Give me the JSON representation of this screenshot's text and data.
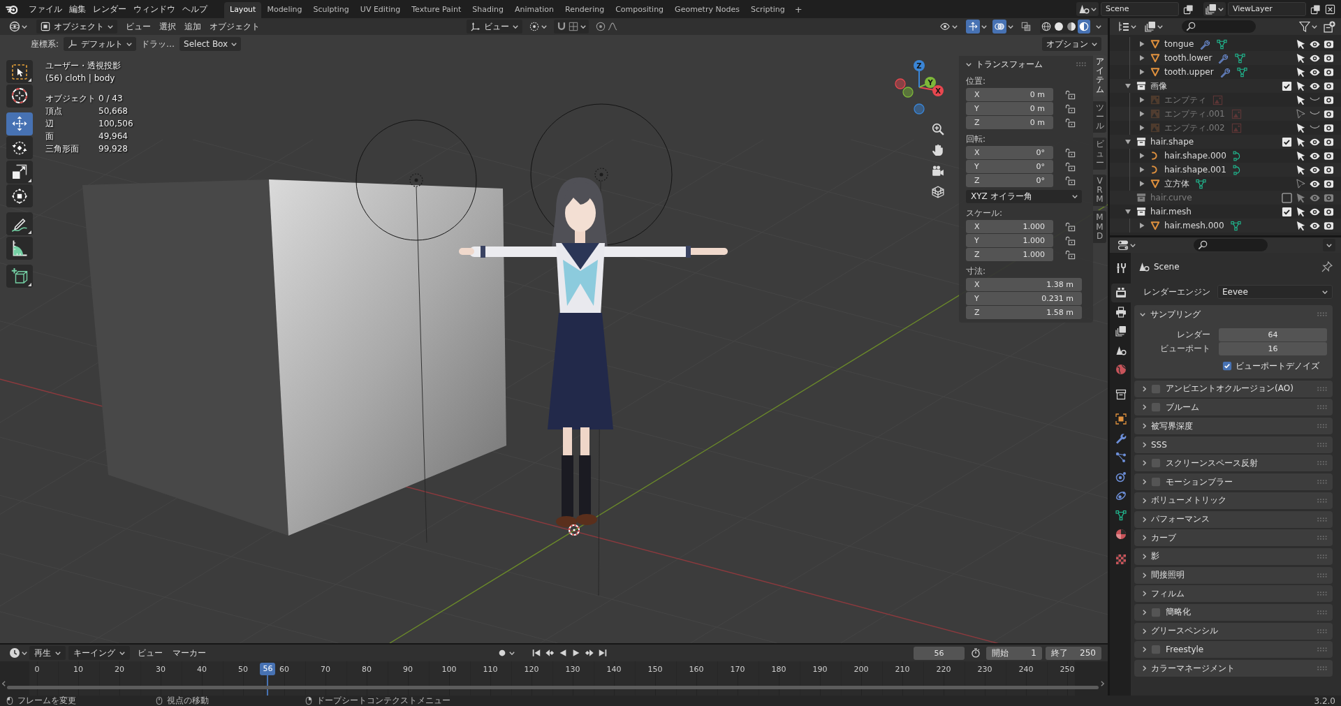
{
  "top_bar": {
    "menus": [
      "ファイル",
      "編集",
      "レンダー",
      "ウィンドウ",
      "ヘルプ"
    ],
    "workspaces": [
      {
        "label": "Layout",
        "selected": true
      },
      {
        "label": "Modeling",
        "selected": false
      },
      {
        "label": "Sculpting",
        "selected": false
      },
      {
        "label": "UV Editing",
        "selected": false
      },
      {
        "label": "Texture Paint",
        "selected": false
      },
      {
        "label": "Shading",
        "selected": false
      },
      {
        "label": "Animation",
        "selected": false
      },
      {
        "label": "Rendering",
        "selected": false
      },
      {
        "label": "Compositing",
        "selected": false
      },
      {
        "label": "Geometry Nodes",
        "selected": false
      },
      {
        "label": "Scripting",
        "selected": false
      }
    ],
    "add_tab": "+",
    "scene": "Scene",
    "view_layer": "ViewLayer"
  },
  "viewport": {
    "header": {
      "mode": "オブジェクト",
      "menus": [
        "ビュー",
        "選択",
        "追加",
        "オブジェクト"
      ],
      "orientation": "ビュー",
      "toggles": [
        {
          "kind": "gizmo",
          "on": true
        },
        {
          "kind": "overlay",
          "on": true
        },
        {
          "kind": "xray",
          "on": false
        }
      ],
      "shading": [
        {
          "kind": "wireframe",
          "selected": false
        },
        {
          "kind": "solid",
          "selected": false
        },
        {
          "kind": "material",
          "selected": false
        },
        {
          "kind": "rendered",
          "selected": true
        }
      ]
    },
    "tool_settings": {
      "orientation_label": "座標系:",
      "orientation": "デフォルト",
      "drag_label": "ドラッ…",
      "drag": "Select Box",
      "options": "オプション"
    },
    "info": {
      "view": "ユーザー・透視投影",
      "context": "(56) cloth | body",
      "stats": [
        {
          "label": "オブジェクト",
          "value": "0 / 43"
        },
        {
          "label": "頂点",
          "value": "50,668"
        },
        {
          "label": "辺",
          "value": "100,506"
        },
        {
          "label": "面",
          "value": "49,964"
        },
        {
          "label": "三角形面",
          "value": "99,928"
        }
      ]
    },
    "tool_groups": [
      {
        "tools": [
          {
            "kind": "select_box",
            "selected": false,
            "variants": true
          },
          {
            "kind": "cursor",
            "selected": false,
            "variants": false
          }
        ]
      },
      {
        "tools": [
          {
            "kind": "move",
            "selected": true,
            "variants": false
          },
          {
            "kind": "rotate",
            "selected": false,
            "variants": false
          },
          {
            "kind": "scale",
            "selected": false,
            "variants": true
          },
          {
            "kind": "transform",
            "selected": false,
            "variants": false
          }
        ]
      },
      {
        "tools": [
          {
            "kind": "annotate",
            "selected": false,
            "variants": true
          },
          {
            "kind": "measure",
            "selected": false,
            "variants": false
          }
        ]
      },
      {
        "tools": [
          {
            "kind": "add_cube",
            "selected": false,
            "variants": true
          }
        ]
      }
    ],
    "gizmo": {
      "axes": [
        {
          "label": "X",
          "color": "#e8474f"
        },
        {
          "label": "Y",
          "color": "#7eb83a"
        },
        {
          "label": "Z",
          "color": "#3a85d6"
        }
      ]
    },
    "sidebar": {
      "title": "トランスフォーム",
      "expanded": true,
      "groups": [
        {
          "label": "位置:",
          "kind": "lockable",
          "fields": [
            {
              "axis": "X",
              "value": "0 m",
              "locked": false
            },
            {
              "axis": "Y",
              "value": "0 m",
              "locked": false
            },
            {
              "axis": "Z",
              "value": "0 m",
              "locked": false
            }
          ]
        },
        {
          "label": "回転:",
          "kind": "lockable",
          "fields": [
            {
              "axis": "X",
              "value": "0°",
              "locked": false
            },
            {
              "axis": "Y",
              "value": "0°",
              "locked": false
            },
            {
              "axis": "Z",
              "value": "0°",
              "locked": false
            }
          ],
          "mode": "XYZ オイラー角"
        },
        {
          "label": "スケール:",
          "kind": "lockable",
          "fields": [
            {
              "axis": "X",
              "value": "1.000",
              "locked": false
            },
            {
              "axis": "Y",
              "value": "1.000",
              "locked": false
            },
            {
              "axis": "Z",
              "value": "1.000",
              "locked": false
            }
          ]
        },
        {
          "label": "寸法:",
          "kind": "plain",
          "fields": [
            {
              "axis": "X",
              "value": "1.38 m"
            },
            {
              "axis": "Y",
              "value": "0.231 m"
            },
            {
              "axis": "Z",
              "value": "1.58 m"
            }
          ]
        }
      ],
      "tabs": [
        {
          "label": "アイテム",
          "selected": true
        },
        {
          "label": "ツール",
          "selected": false
        },
        {
          "label": "ビュー",
          "selected": false
        },
        {
          "label": "VRM",
          "selected": false
        },
        {
          "label": "MMD",
          "selected": false
        }
      ]
    }
  },
  "outliner": {
    "items": [
      {
        "kind": "continued",
        "children": [
          {
            "name": "tongue",
            "kind": "mesh",
            "expanded": false,
            "has_modifiers": true,
            "selectable": true,
            "visible": true
          },
          {
            "name": "tooth.lower",
            "kind": "mesh",
            "expanded": false,
            "has_modifiers": true,
            "selectable": true,
            "visible": true
          },
          {
            "name": "tooth.upper",
            "kind": "mesh",
            "expanded": false,
            "has_modifiers": true,
            "selectable": true,
            "visible": true
          }
        ]
      },
      {
        "name": "画像",
        "kind": "collection",
        "expanded": true,
        "included": true,
        "selectable": true,
        "visible": true,
        "children": [
          {
            "name": "エンプティ",
            "kind": "image_empty",
            "expanded": false,
            "has_modifiers": false,
            "selectable": true,
            "visible": false
          },
          {
            "name": "エンプティ.001",
            "kind": "image_empty",
            "expanded": false,
            "has_modifiers": false,
            "selectable": false,
            "visible": false
          },
          {
            "name": "エンプティ.002",
            "kind": "image_empty",
            "expanded": false,
            "has_modifiers": false,
            "selectable": true,
            "visible": false
          }
        ]
      },
      {
        "name": "hair.shape",
        "kind": "collection",
        "expanded": true,
        "included": true,
        "selectable": true,
        "visible": true,
        "children": [
          {
            "name": "hair.shape.000",
            "kind": "curve",
            "expanded": false,
            "has_modifiers": false,
            "selectable": true,
            "visible": true
          },
          {
            "name": "hair.shape.001",
            "kind": "curve",
            "expanded": false,
            "has_modifiers": false,
            "selectable": true,
            "visible": true
          },
          {
            "name": "立方体",
            "kind": "mesh",
            "expanded": false,
            "has_modifiers": false,
            "selectable": false,
            "visible": true
          }
        ]
      },
      {
        "name": "hair.curve",
        "kind": "collection",
        "expanded": false,
        "included": false,
        "selectable": true,
        "visible": true
      },
      {
        "name": "hair.mesh",
        "kind": "collection",
        "expanded": true,
        "included": true,
        "selectable": true,
        "visible": true,
        "children": [
          {
            "name": "hair.mesh.000",
            "kind": "mesh",
            "expanded": false,
            "has_modifiers": false,
            "selectable": true,
            "visible": true
          }
        ]
      }
    ]
  },
  "properties": {
    "tab_groups": [
      {
        "tabs": [
          {
            "kind": "tool",
            "selected": false
          }
        ]
      },
      {
        "tabs": [
          {
            "kind": "render",
            "selected": true
          },
          {
            "kind": "output",
            "selected": false
          },
          {
            "kind": "view_layer",
            "selected": false
          },
          {
            "kind": "scene",
            "selected": false
          },
          {
            "kind": "world",
            "selected": false
          }
        ]
      },
      {
        "tabs": [
          {
            "kind": "collection",
            "selected": false
          }
        ]
      },
      {
        "tabs": [
          {
            "kind": "object",
            "selected": false
          },
          {
            "kind": "modifiers",
            "selected": false
          },
          {
            "kind": "particles",
            "selected": false
          },
          {
            "kind": "physics",
            "selected": false
          },
          {
            "kind": "constraints",
            "selected": false
          },
          {
            "kind": "data",
            "selected": false
          },
          {
            "kind": "material",
            "selected": false
          }
        ]
      },
      {
        "tabs": [
          {
            "kind": "texture",
            "selected": false
          }
        ]
      }
    ],
    "context": "Scene",
    "engine_label": "レンダーエンジン",
    "engine": "Eevee",
    "sampling": {
      "title": "サンプリング",
      "expanded": true,
      "fields": [
        {
          "label": "レンダー",
          "value": "64"
        },
        {
          "label": "ビューポート",
          "value": "16"
        }
      ],
      "denoise": {
        "label": "ビューポートデノイズ",
        "checked": true
      }
    },
    "panels": [
      {
        "title": "アンビエントオクルージョン(AO)",
        "kind": "toggle",
        "checked": false,
        "expanded": false
      },
      {
        "title": "ブルーム",
        "kind": "toggle",
        "checked": false,
        "expanded": false
      },
      {
        "title": "被写界深度",
        "kind": "plain",
        "expanded": false
      },
      {
        "title": "SSS",
        "kind": "plain",
        "expanded": false
      },
      {
        "title": "スクリーンスペース反射",
        "kind": "toggle",
        "checked": false,
        "expanded": false
      },
      {
        "title": "モーションブラー",
        "kind": "toggle",
        "checked": false,
        "expanded": false
      },
      {
        "title": "ボリューメトリック",
        "kind": "plain",
        "expanded": false
      },
      {
        "title": "パフォーマンス",
        "kind": "plain",
        "expanded": false
      },
      {
        "title": "カーブ",
        "kind": "plain",
        "expanded": false
      },
      {
        "title": "影",
        "kind": "plain",
        "expanded": false
      },
      {
        "title": "間接照明",
        "kind": "plain",
        "expanded": false
      },
      {
        "title": "フィルム",
        "kind": "plain",
        "expanded": false
      },
      {
        "title": "簡略化",
        "kind": "toggle",
        "checked": false,
        "expanded": false
      },
      {
        "title": "グリースペンシル",
        "kind": "plain",
        "expanded": false
      },
      {
        "title": "Freestyle",
        "kind": "toggle",
        "checked": false,
        "expanded": false
      },
      {
        "title": "カラーマネージメント",
        "kind": "plain",
        "expanded": false
      }
    ]
  },
  "timeline": {
    "menus": [
      {
        "label": "再生",
        "dropdown": true
      },
      {
        "label": "キーイング",
        "dropdown": true
      },
      {
        "label": "ビュー",
        "dropdown": false
      },
      {
        "label": "マーカー",
        "dropdown": false
      }
    ],
    "auto_keying": false,
    "frame": "56",
    "start_label": "開始",
    "start": "1",
    "end_label": "終了",
    "end": "250",
    "ruler": [
      "0",
      "10",
      "20",
      "30",
      "40",
      "50",
      "60",
      "70",
      "80",
      "90",
      "100",
      "110",
      "120",
      "130",
      "140",
      "150",
      "160",
      "170",
      "180",
      "190",
      "200",
      "210",
      "220",
      "230",
      "240",
      "250"
    ],
    "playhead": {
      "label": "56",
      "level": 0.224
    }
  },
  "status_bar": {
    "hints": [
      {
        "kind": "left",
        "label": "フレームを変更"
      },
      {
        "kind": "middle",
        "label": "視点の移動"
      },
      {
        "kind": "right",
        "label": "ドープシートコンテクストメニュー"
      }
    ],
    "version": "3.2.0"
  }
}
